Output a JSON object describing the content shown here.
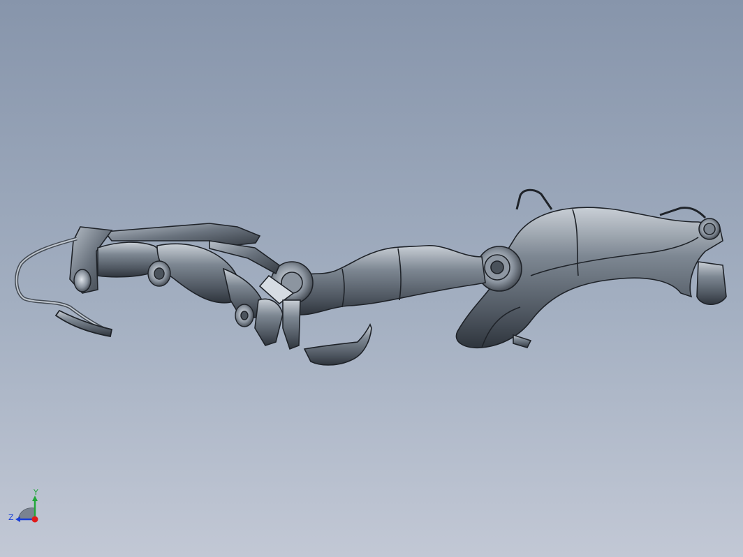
{
  "viewport": {
    "background_top": "#8795ab",
    "background_bottom": "#c2c8d5",
    "model_color": "#6b7581",
    "edge_color": "#1f2329"
  },
  "triad": {
    "y_label": "Y",
    "z_label": "Z",
    "x_color": "#e01b1b",
    "y_color": "#22a83a",
    "z_color": "#1a3fd6"
  }
}
